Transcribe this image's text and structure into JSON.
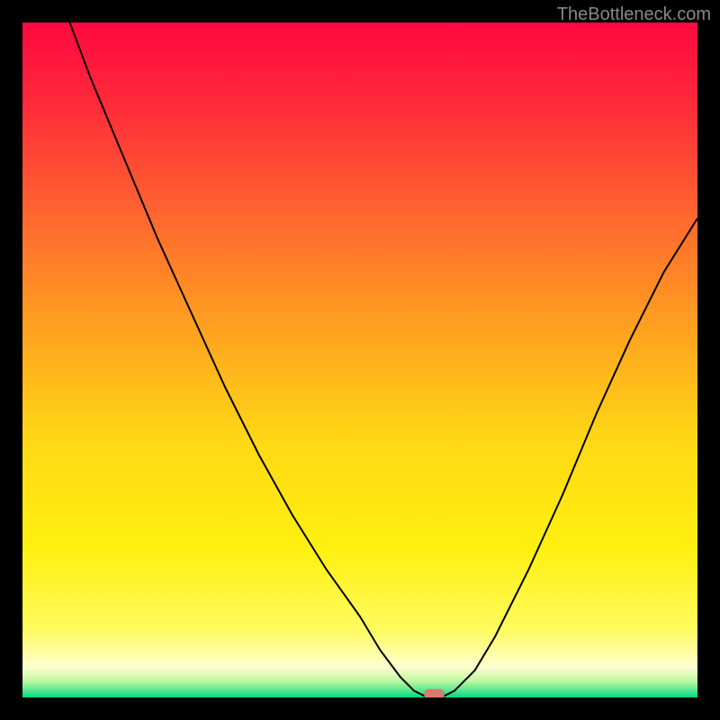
{
  "watermark": "TheBottleneck.com",
  "chart_data": {
    "type": "line",
    "title": "",
    "xlabel": "",
    "ylabel": "",
    "xlim": [
      0,
      100
    ],
    "ylim": [
      0,
      100
    ],
    "curve": [
      {
        "x": 7,
        "y": 100
      },
      {
        "x": 10,
        "y": 92
      },
      {
        "x": 15,
        "y": 80
      },
      {
        "x": 20,
        "y": 68
      },
      {
        "x": 25,
        "y": 57
      },
      {
        "x": 30,
        "y": 46
      },
      {
        "x": 35,
        "y": 36
      },
      {
        "x": 40,
        "y": 27
      },
      {
        "x": 45,
        "y": 19
      },
      {
        "x": 50,
        "y": 12
      },
      {
        "x": 53,
        "y": 7
      },
      {
        "x": 56,
        "y": 3
      },
      {
        "x": 58,
        "y": 1
      },
      {
        "x": 60,
        "y": 0
      },
      {
        "x": 62,
        "y": 0
      },
      {
        "x": 64,
        "y": 1
      },
      {
        "x": 67,
        "y": 4
      },
      {
        "x": 70,
        "y": 9
      },
      {
        "x": 75,
        "y": 19
      },
      {
        "x": 80,
        "y": 30
      },
      {
        "x": 85,
        "y": 42
      },
      {
        "x": 90,
        "y": 53
      },
      {
        "x": 95,
        "y": 63
      },
      {
        "x": 100,
        "y": 71
      }
    ],
    "marker": {
      "x": 61,
      "y": 0.5,
      "width": 3,
      "height": 1.5,
      "color": "#d97b6f"
    },
    "gradient": {
      "background": [
        {
          "offset": 0,
          "color": "#ff0840"
        },
        {
          "offset": 0.12,
          "color": "#ff2a3a"
        },
        {
          "offset": 0.28,
          "color": "#ff6430"
        },
        {
          "offset": 0.45,
          "color": "#ffa020"
        },
        {
          "offset": 0.62,
          "color": "#ffd815"
        },
        {
          "offset": 0.78,
          "color": "#fff010"
        },
        {
          "offset": 0.9,
          "color": "#fffb60"
        },
        {
          "offset": 0.955,
          "color": "#fdffd0"
        },
        {
          "offset": 0.975,
          "color": "#c0f7a0"
        },
        {
          "offset": 0.99,
          "color": "#50e890"
        },
        {
          "offset": 1.0,
          "color": "#00d880"
        }
      ]
    }
  }
}
